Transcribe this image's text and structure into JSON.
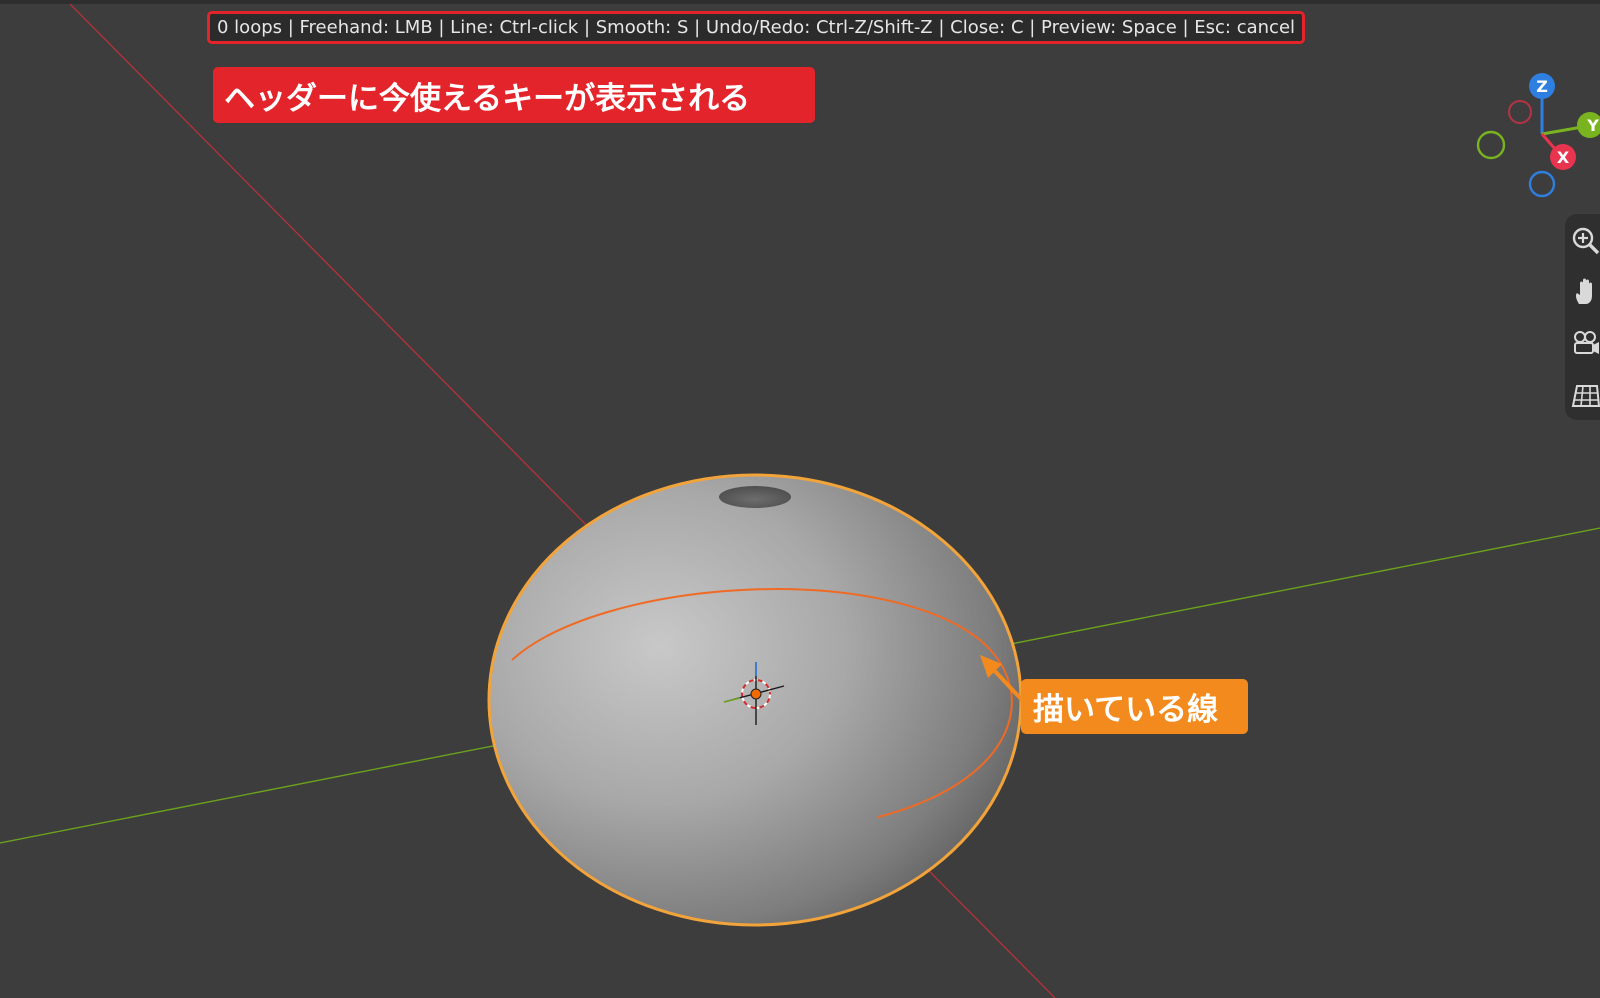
{
  "header": {
    "status_text": "0 loops | Freehand: LMB | Line: Ctrl-click | Smooth: S | Undo/Redo: Ctrl-Z/Shift-Z | Close: C | Preview: Space | Esc: cancel"
  },
  "annotations": {
    "header_note": "ヘッダーに今使えるキーが表示される",
    "drawing_line_note": "描いている線"
  },
  "gizmo": {
    "z_label": "Z",
    "y_label": "Y",
    "x_label": "X"
  },
  "colors": {
    "viewport_bg": "#3d3d3d",
    "annotation_red": "#e3242b",
    "annotation_orange": "#f28a1e",
    "axis_x": "#e8344f",
    "axis_y": "#7ab320",
    "axis_z": "#2f7fe0",
    "selection_outline": "#f2a33a"
  },
  "tools": [
    "zoom-icon",
    "hand-pan-icon",
    "camera-icon",
    "grid-view-icon"
  ]
}
